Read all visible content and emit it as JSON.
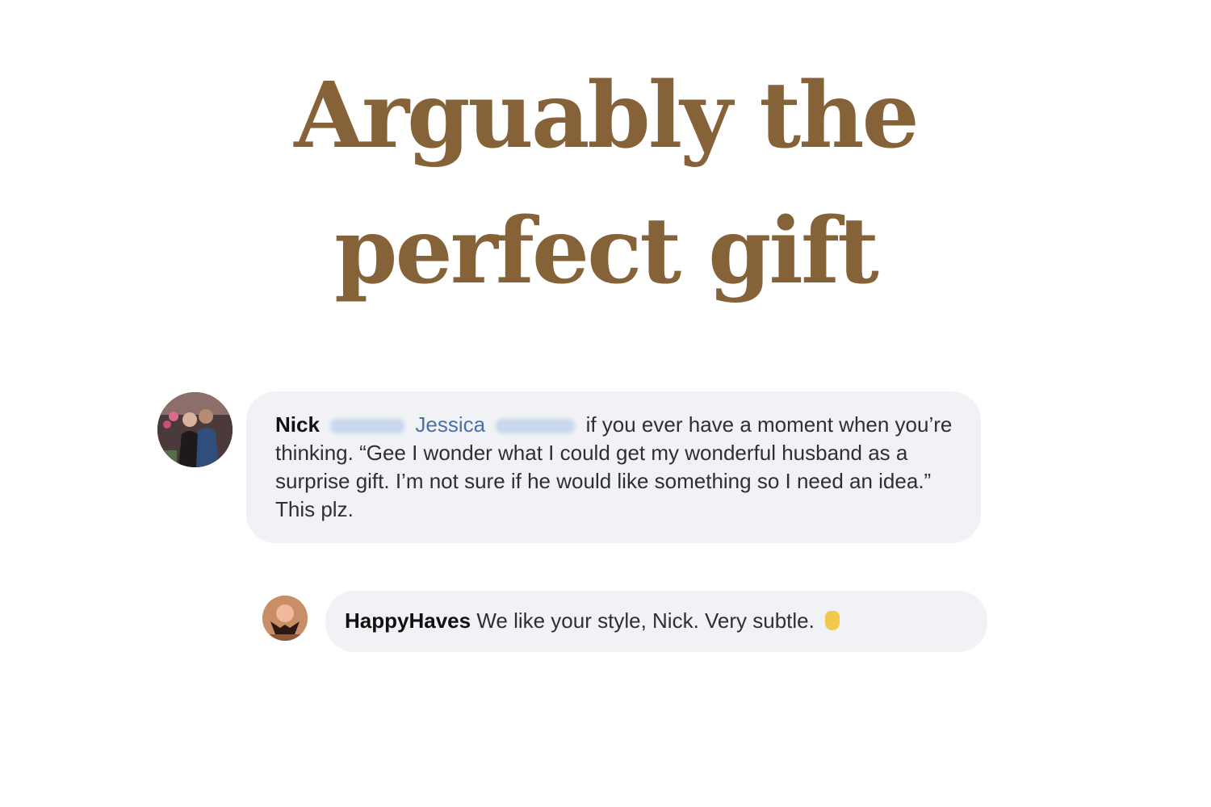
{
  "headline": {
    "line1": "Arguably the",
    "line2": "perfect gift"
  },
  "comments": [
    {
      "author": "Nick",
      "mention": "Jessica",
      "text": "if you ever have a moment when you’re thinking. “Gee I wonder what I could get my wonderful husband as a surprise gift. I’m not sure if he would like something so I need an idea.” This plz."
    },
    {
      "author": "HappyHaves",
      "text": "We like your style, Nick. Very subtle."
    }
  ],
  "colors": {
    "headline": "#856238",
    "bubble": "#f0f2f5",
    "mention": "#4b70a8"
  },
  "icons": {
    "emoji": "ok-hand-emoji"
  }
}
